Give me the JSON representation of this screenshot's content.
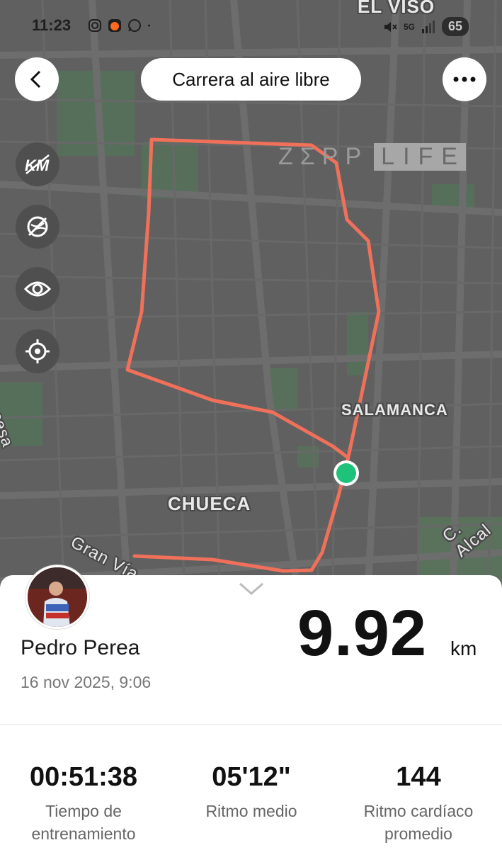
{
  "status_bar": {
    "time": "11:23",
    "battery": "65",
    "network": "5G"
  },
  "map": {
    "districts": {
      "el_viso": "EL VISO",
      "salamanca": "SALAMANCA",
      "chueca": "CHUECA"
    },
    "streets": {
      "gran_via": "Gran Vía",
      "alcala": "C. Alcal",
      "princesa": "ncesa"
    },
    "watermark": {
      "brand": "ZΣPP",
      "brand_suffix": "LIFE"
    },
    "route_color": "#f0705a",
    "marker_color": "#1ec27a"
  },
  "header": {
    "title": "Carrera al aire libre"
  },
  "controls": [
    "km-icon",
    "map-layer-off-icon",
    "eye-icon",
    "locate-icon"
  ],
  "summary": {
    "user_name": "Pedro Perea",
    "date": "16 nov 2025, 9:06",
    "distance": "9.92",
    "distance_unit": "km"
  },
  "stats": [
    {
      "value": "00:51:38",
      "label_line1": "Tiempo de",
      "label_line2": "entrenamiento"
    },
    {
      "value": "05'12\"",
      "label_line1": "Ritmo medio",
      "label_line2": ""
    },
    {
      "value": "144",
      "label_line1": "Ritmo cardíaco",
      "label_line2": "promedio"
    }
  ]
}
